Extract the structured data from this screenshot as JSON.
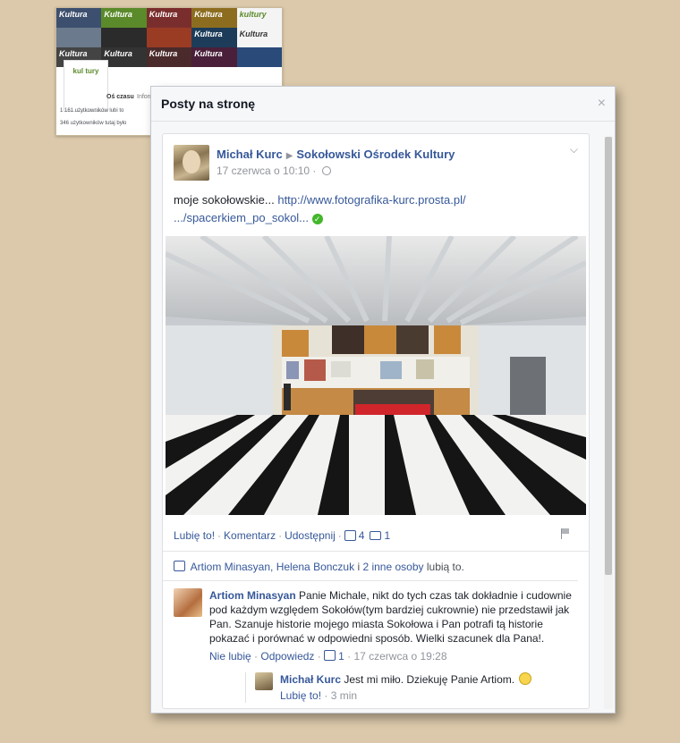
{
  "background_thumbnail": {
    "tiles": [
      "Kultura",
      "Kultura",
      "Kultura",
      "Kultura",
      "kultury",
      "",
      "",
      "",
      "Kultura",
      "Kultura",
      "Kultura",
      "Kultura",
      "Kultura",
      "Kultura",
      ""
    ],
    "logo_text": "kul tury",
    "tab_active": "Oś czasu",
    "tab_other": "Informacje",
    "rows": [
      "1 161 użytkowników lubi to",
      "346 użytkowników tutaj było"
    ]
  },
  "dialog": {
    "title": "Posty na stronę",
    "close": "×"
  },
  "post": {
    "author": "Michał Kurc",
    "arrow": "▶",
    "target_page": "Sokołowski Ośrodek Kultury",
    "date": "17 czerwca o 10:10 ·",
    "text_prefix": "moje sokołowskie...",
    "link_line1": "http://www.fotografika-kurc.prosta.pl/",
    "link_line2": ".../spacerkiem_po_sokol...",
    "actions": {
      "like": "Lubię to!",
      "comment": "Komentarz",
      "share": "Udostępnij",
      "like_count": "4",
      "comment_count": "1"
    },
    "likes_summary": {
      "names": "Artiom Minasyan, Helena Bonczuk",
      "connector": "i",
      "others": "2 inne osoby",
      "suffix": "lubią to."
    }
  },
  "comment": {
    "author": "Artiom Minasyan",
    "text": "Panie Michale, nikt do tych czas tak dokładnie i cudownie pod każdym względem Sokołów(tym bardziej cukrownie) nie przedstawił jak Pan. Szanuje historie mojego miasta Sokołowa i Pan potrafi tą historie pokazać i porównać w odpowiedni sposób. Wielki szacunek dla Pana!.",
    "unlike": "Nie lubię",
    "reply": "Odpowiedz",
    "like_count": "1",
    "date": "17 czerwca o 19:28"
  },
  "reply": {
    "author": "Michał Kurc",
    "text": "Jest mi miło. Dziekuję Panie Artiom.",
    "like": "Lubię to!",
    "time": "3 min"
  }
}
